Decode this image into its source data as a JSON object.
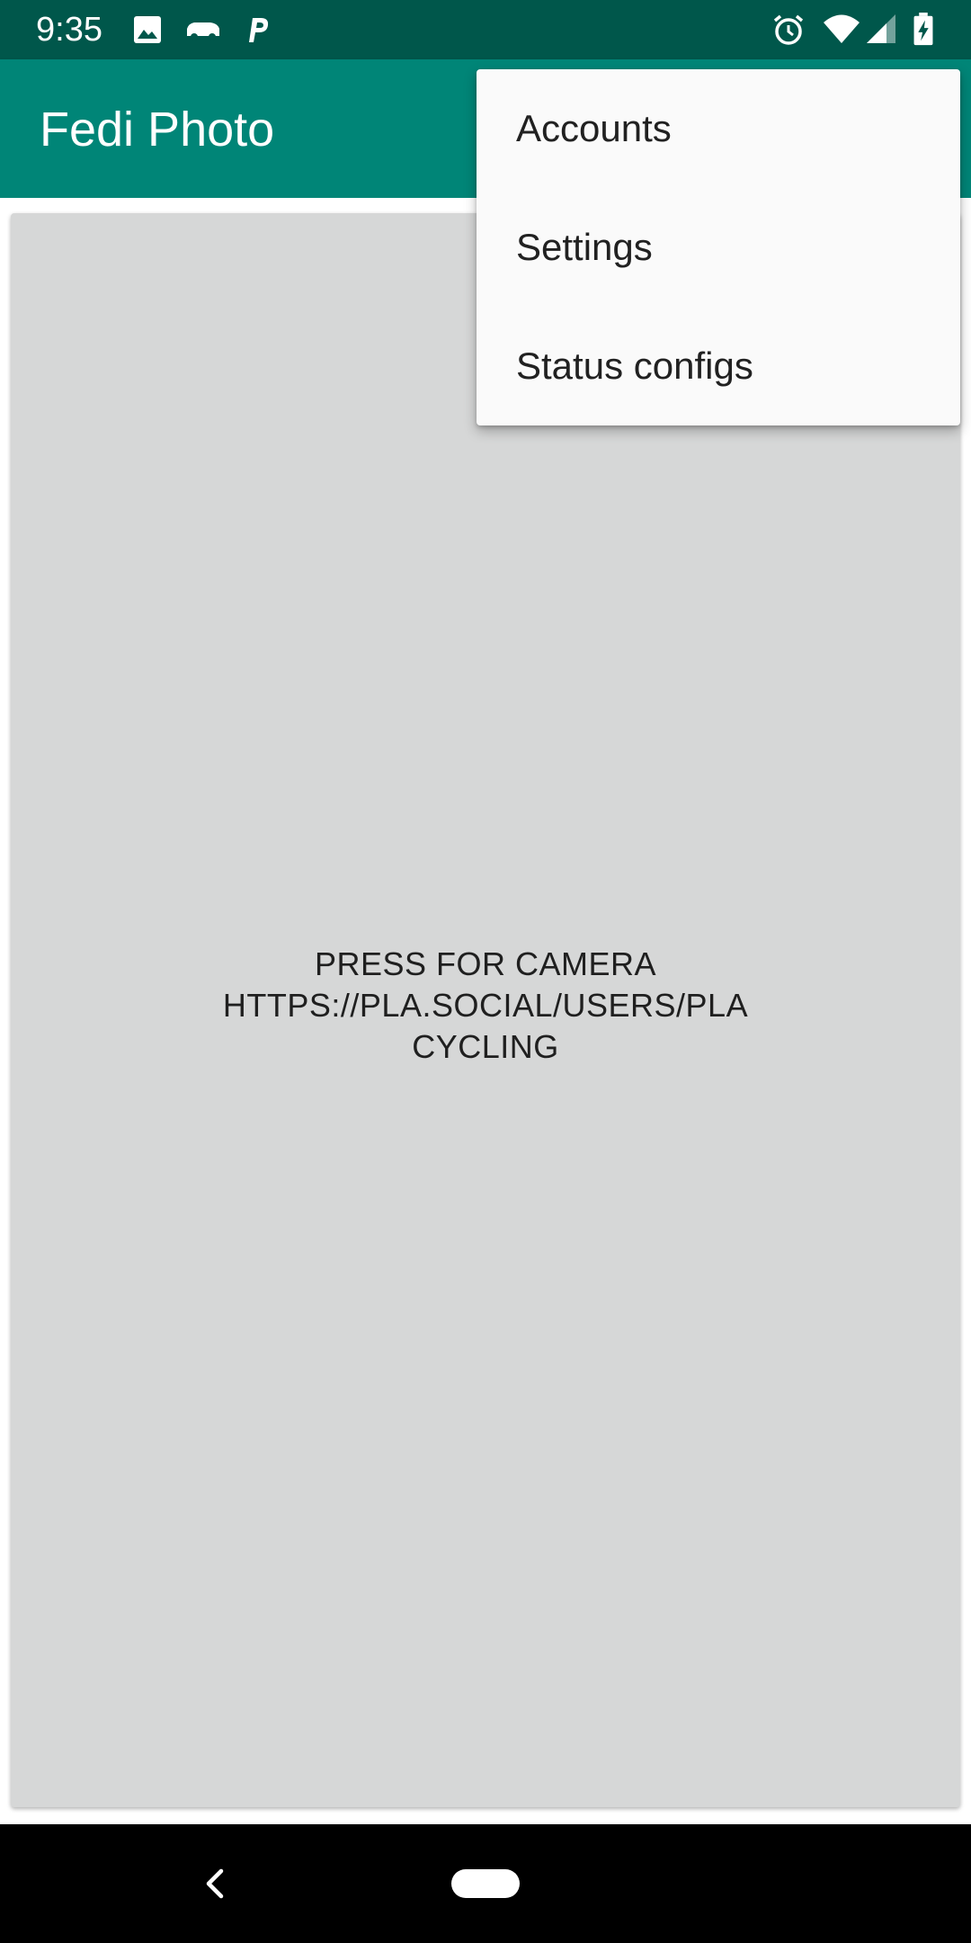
{
  "status_bar": {
    "time": "9:35",
    "left_icons": [
      "image-icon",
      "car-icon",
      "parking-icon"
    ],
    "right_icons": [
      "alarm-icon",
      "wifi-icon",
      "signal-icon",
      "battery-charging-icon"
    ]
  },
  "app_bar": {
    "title": "Fedi Photo"
  },
  "camera_button": {
    "line1": "PRESS FOR CAMERA",
    "line2": "HTTPS://PLA.SOCIAL/USERS/PLA",
    "line3": "CYCLING"
  },
  "overflow_menu": {
    "items": [
      {
        "label": "Accounts"
      },
      {
        "label": "Settings"
      },
      {
        "label": "Status configs"
      }
    ]
  },
  "nav_bar": {
    "icons": [
      "back-icon",
      "home-pill-icon"
    ]
  },
  "colors": {
    "status_bar": "#00574B",
    "app_bar": "#008577",
    "button_bg": "#D6D7D7",
    "menu_bg": "#FAFAFA"
  }
}
